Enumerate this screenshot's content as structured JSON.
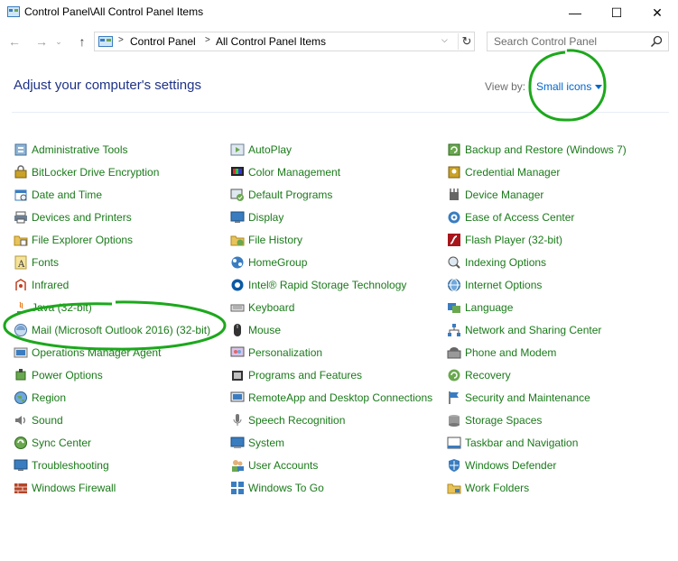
{
  "window": {
    "title": "Control Panel\\All Control Panel Items",
    "minimize_glyph": "—",
    "maximize_glyph": "☐",
    "close_glyph": "✕"
  },
  "nav": {
    "back_glyph": "←",
    "forward_glyph": "→",
    "recent_glyph": "⌄",
    "up_glyph": "↑",
    "refresh_glyph": "↻"
  },
  "address": {
    "separator": ">",
    "crumbs": [
      "Control Panel",
      "All Control Panel Items"
    ]
  },
  "search": {
    "placeholder": "Search Control Panel",
    "value": ""
  },
  "header": {
    "title": "Adjust your computer's settings",
    "view_by_label": "View by:",
    "view_by_value": "Small icons"
  },
  "colors": {
    "link": "#1a7a1a",
    "heading": "#1e3287",
    "annotation": "#1ca81c",
    "accent": "#0066cc"
  },
  "items": {
    "col1": [
      {
        "label": "Administrative Tools",
        "icon": "admin-tools-icon"
      },
      {
        "label": "BitLocker Drive Encryption",
        "icon": "bitlocker-icon"
      },
      {
        "label": "Date and Time",
        "icon": "date-time-icon"
      },
      {
        "label": "Devices and Printers",
        "icon": "printer-icon"
      },
      {
        "label": "File Explorer Options",
        "icon": "folder-options-icon"
      },
      {
        "label": "Fonts",
        "icon": "fonts-icon"
      },
      {
        "label": "Infrared",
        "icon": "infrared-icon"
      },
      {
        "label": "Java (32-bit)",
        "icon": "java-icon"
      },
      {
        "label": "Mail (Microsoft Outlook 2016) (32-bit)",
        "icon": "mail-icon"
      },
      {
        "label": "Operations Manager Agent",
        "icon": "ops-manager-icon"
      },
      {
        "label": "Power Options",
        "icon": "power-icon"
      },
      {
        "label": "Region",
        "icon": "region-icon"
      },
      {
        "label": "Sound",
        "icon": "sound-icon"
      },
      {
        "label": "Sync Center",
        "icon": "sync-icon"
      },
      {
        "label": "Troubleshooting",
        "icon": "troubleshooting-icon"
      },
      {
        "label": "Windows Firewall",
        "icon": "firewall-icon"
      }
    ],
    "col2": [
      {
        "label": "AutoPlay",
        "icon": "autoplay-icon"
      },
      {
        "label": "Color Management",
        "icon": "color-management-icon"
      },
      {
        "label": "Default Programs",
        "icon": "default-programs-icon"
      },
      {
        "label": "Display",
        "icon": "display-icon"
      },
      {
        "label": "File History",
        "icon": "file-history-icon"
      },
      {
        "label": "HomeGroup",
        "icon": "homegroup-icon"
      },
      {
        "label": "Intel® Rapid Storage Technology",
        "icon": "intel-storage-icon"
      },
      {
        "label": "Keyboard",
        "icon": "keyboard-icon"
      },
      {
        "label": "Mouse",
        "icon": "mouse-icon"
      },
      {
        "label": "Personalization",
        "icon": "personalization-icon"
      },
      {
        "label": "Programs and Features",
        "icon": "programs-icon"
      },
      {
        "label": "RemoteApp and Desktop Connections",
        "icon": "remoteapp-icon"
      },
      {
        "label": "Speech Recognition",
        "icon": "speech-icon"
      },
      {
        "label": "System",
        "icon": "system-icon"
      },
      {
        "label": "User Accounts",
        "icon": "user-accounts-icon"
      },
      {
        "label": "Windows To Go",
        "icon": "windows-to-go-icon"
      }
    ],
    "col3": [
      {
        "label": "Backup and Restore (Windows 7)",
        "icon": "backup-icon"
      },
      {
        "label": "Credential Manager",
        "icon": "credential-icon"
      },
      {
        "label": "Device Manager",
        "icon": "device-manager-icon"
      },
      {
        "label": "Ease of Access Center",
        "icon": "ease-of-access-icon"
      },
      {
        "label": "Flash Player (32-bit)",
        "icon": "flash-icon"
      },
      {
        "label": "Indexing Options",
        "icon": "indexing-icon"
      },
      {
        "label": "Internet Options",
        "icon": "internet-options-icon"
      },
      {
        "label": "Language",
        "icon": "language-icon"
      },
      {
        "label": "Network and Sharing Center",
        "icon": "network-icon"
      },
      {
        "label": "Phone and Modem",
        "icon": "phone-modem-icon"
      },
      {
        "label": "Recovery",
        "icon": "recovery-icon"
      },
      {
        "label": "Security and Maintenance",
        "icon": "security-flag-icon"
      },
      {
        "label": "Storage Spaces",
        "icon": "storage-icon"
      },
      {
        "label": "Taskbar and Navigation",
        "icon": "taskbar-icon"
      },
      {
        "label": "Windows Defender",
        "icon": "defender-icon"
      },
      {
        "label": "Work Folders",
        "icon": "work-folders-icon"
      }
    ]
  }
}
